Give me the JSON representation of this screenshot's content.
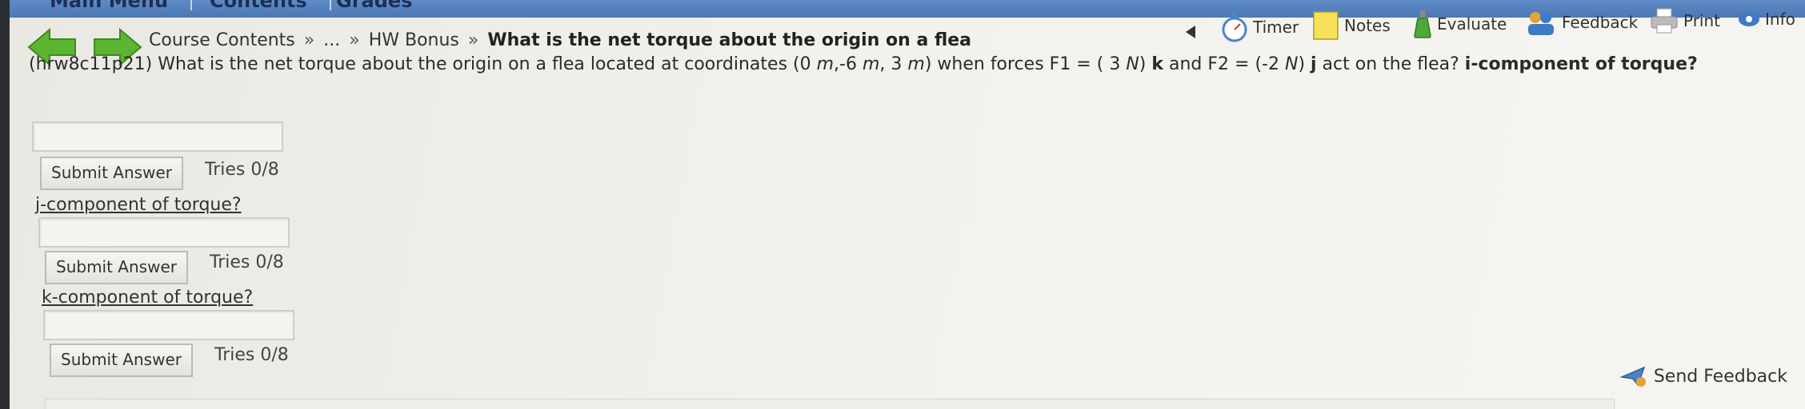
{
  "topnav": {
    "tabs": [
      "Main Menu",
      "Contents",
      "Grades"
    ]
  },
  "breadcrumb": {
    "items": [
      "Course Contents",
      "...",
      "HW Bonus"
    ],
    "current": "What is the net torque about the origin on a flea",
    "separator": "»"
  },
  "toolbar": {
    "timer": "Timer",
    "notes": "Notes",
    "evaluate": "Evaluate",
    "feedback": "Feedback",
    "print": "Print",
    "info": "Info"
  },
  "question": {
    "id": "(hrw8c11p21)",
    "text_a": " What is the net torque about the origin on a flea located at coordinates (0 ",
    "m1": "m",
    "text_b": ",-6 ",
    "m2": "m",
    "text_c": ", 3 ",
    "m3": "m",
    "text_d": ") when forces F1 = ( 3 ",
    "n1": "N",
    "text_e": ") ",
    "k_bold": "k",
    "text_f": " and F2 = (-2 ",
    "n2": "N",
    "text_g": ") ",
    "j_bold": "j",
    "text_h": " act on the flea? ",
    "first_prompt": "i-component of torque?"
  },
  "parts": [
    {
      "label": "",
      "submit": "Submit Answer",
      "tries": "Tries 0/8"
    },
    {
      "label": "j-component of torque?",
      "submit": "Submit Answer",
      "tries": "Tries 0/8"
    },
    {
      "label": "k-component of torque?",
      "submit": "Submit Answer",
      "tries": "Tries 0/8"
    }
  ],
  "send_feedback": "Send Feedback",
  "colors": {
    "nav_blue": "#4b78b6",
    "arrow_green": "#5cb531",
    "background": "#ecebe6"
  }
}
